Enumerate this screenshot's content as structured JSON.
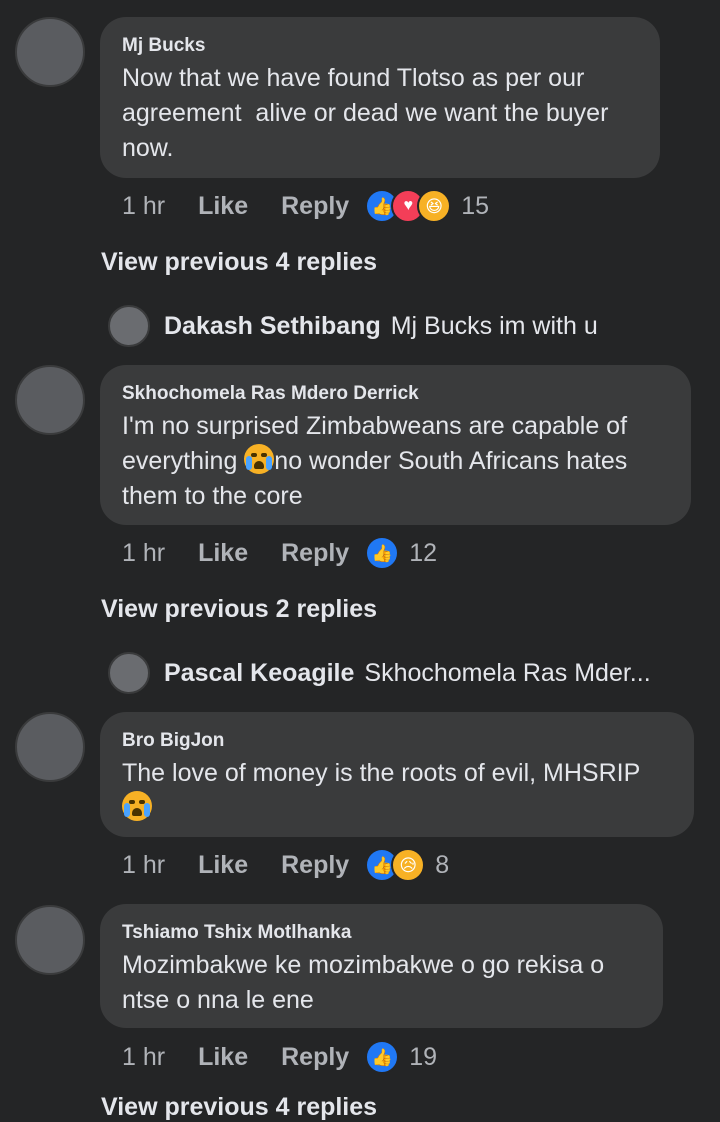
{
  "comments": [
    {
      "author": "Mj Bucks",
      "text": "Now that we have found Tlotso as per our agreement  alive or dead we want the buyer now.",
      "time": "1 hr",
      "like_label": "Like",
      "reply_label": "Reply",
      "reactions": [
        "like",
        "love",
        "haha"
      ],
      "reaction_count": "15",
      "view_previous": "View previous 4 replies",
      "reply_preview": {
        "author": "Dakash Sethibang",
        "text": "Mj Bucks im with u"
      }
    },
    {
      "author": "Skhochomela Ras Mdero Derrick",
      "text_before_emoji": "I'm no surprised Zimbabweans are capable of everything ",
      "text_after_emoji": "no wonder South Africans hates them to the core",
      "time": "1 hr",
      "like_label": "Like",
      "reply_label": "Reply",
      "reactions": [
        "like"
      ],
      "reaction_count": "12",
      "view_previous": "View previous 2 replies",
      "reply_preview": {
        "author": "Pascal Keoagile",
        "text": "Skhochomela Ras Mder..."
      }
    },
    {
      "author": "Bro BigJon",
      "text": "The love of money is the roots of evil, MHSRIP",
      "time": "1 hr",
      "like_label": "Like",
      "reply_label": "Reply",
      "reactions": [
        "like",
        "sad"
      ],
      "reaction_count": "8"
    },
    {
      "author": "Tshiamo Tshix Motlhanka",
      "text": "Mozimbakwe ke mozimbakwe o go rekisa o ntse o nna le ene",
      "time": "1 hr",
      "like_label": "Like",
      "reply_label": "Reply",
      "reactions": [
        "like"
      ],
      "reaction_count": "19"
    }
  ],
  "footer_cutoff": "View previous 4 replies",
  "colors": {
    "background": "#242526",
    "bubble": "#3a3b3c",
    "like_blue": "#2078f4",
    "love_red": "#f33e58",
    "emoji_yellow": "#f7b125"
  }
}
